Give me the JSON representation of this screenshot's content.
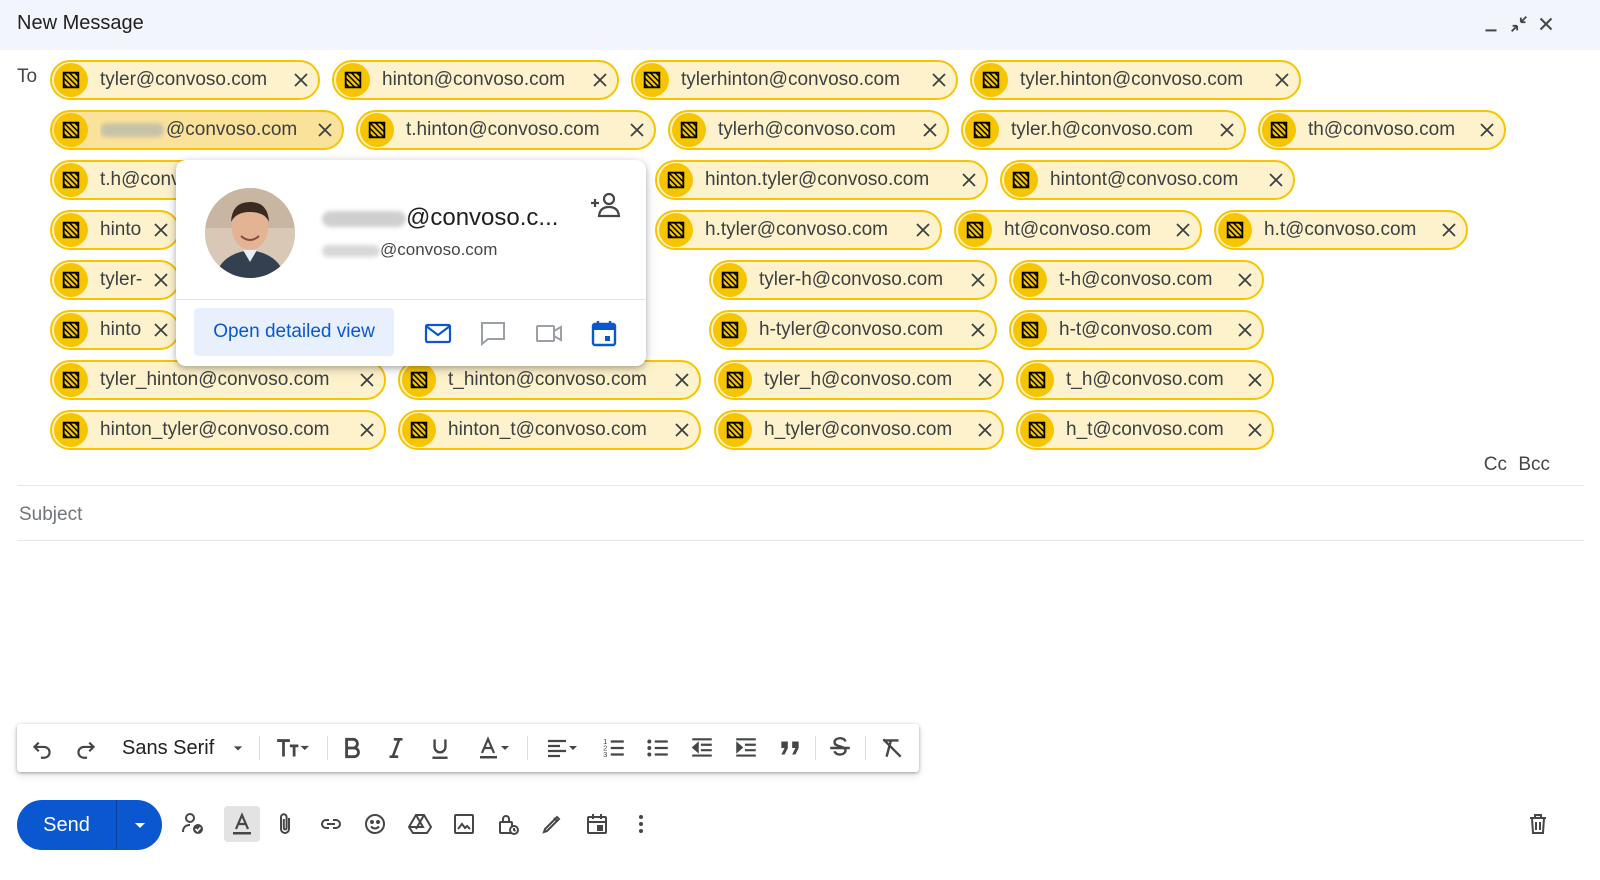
{
  "window": {
    "title": "New Message"
  },
  "recipients": {
    "to_label": "To",
    "chips": [
      {
        "email": "tyler@convoso.com"
      },
      {
        "email": "hinton@convoso.com"
      },
      {
        "email": "tylerhinton@convoso.com"
      },
      {
        "email": "tyler.hinton@convoso.com"
      },
      {
        "email": "@convoso.com"
      },
      {
        "email": "t.hinton@convoso.com"
      },
      {
        "email": "tylerh@convoso.com"
      },
      {
        "email": "tyler.h@convoso.com"
      },
      {
        "email": "th@convoso.com"
      },
      {
        "email": "t.h@conv"
      },
      {
        "email": "hinton.tyler@convoso.com"
      },
      {
        "email": "hintont@convoso.com"
      },
      {
        "email": "hinton.t"
      },
      {
        "email": "h.tyler@convoso.com"
      },
      {
        "email": "ht@convoso.com"
      },
      {
        "email": "h.t@convoso.com"
      },
      {
        "email": "tyler-hint"
      },
      {
        "email": "tyler-h@convoso.com"
      },
      {
        "email": "t-h@convoso.com"
      },
      {
        "email": "hinton-ty"
      },
      {
        "email": "h-tyler@convoso.com"
      },
      {
        "email": "h-t@convoso.com"
      },
      {
        "email": "tyler_hinton@convoso.com"
      },
      {
        "email": "t_hinton@convoso.com"
      },
      {
        "email": "tyler_h@convoso.com"
      },
      {
        "email": "t_h@convoso.com"
      },
      {
        "email": "hinton_tyler@convoso.com"
      },
      {
        "email": "hinton_t@convoso.com"
      },
      {
        "email": "h_tyler@convoso.com"
      },
      {
        "email": "h_t@convoso.com"
      }
    ],
    "cc_label": "Cc",
    "bcc_label": "Bcc"
  },
  "subject": {
    "placeholder": "Subject",
    "value": ""
  },
  "contact_card": {
    "name_suffix": "@convoso.c...",
    "email_suffix": "@convoso.com",
    "open_detailed_view_label": "Open detailed view"
  },
  "format_toolbar": {
    "font_family": "Sans Serif"
  },
  "send_button": {
    "label": "Send"
  },
  "colors": {
    "chip_background": "#fdf2cc",
    "chip_border": "#f7c500",
    "send_blue": "#0b57d0",
    "header_background": "#f2f6fc"
  }
}
